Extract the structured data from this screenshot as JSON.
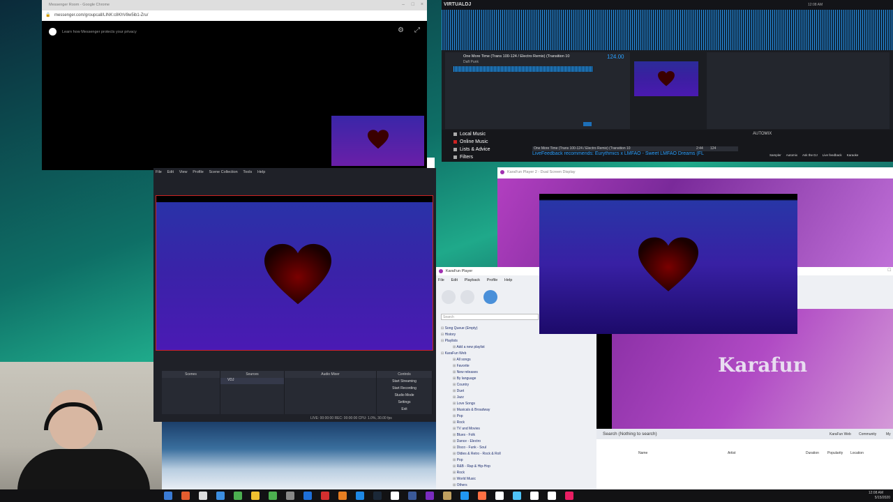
{
  "messenger": {
    "window_title": "Messenger Room - Google Chrome",
    "url": "messenger.com/groupcall/LINK:c8KhV8w5ib1-Zru/",
    "privacy_text": "Learn how Messenger protects your privacy"
  },
  "virtualdj": {
    "logo": "VIRTUALDJ",
    "clock": "12:08 AM",
    "track_title": "One More Time (Trans 100-124 / Electro Remix) (Transition 10",
    "track_artist": "Daft Punk",
    "bpm": "124.00",
    "browser_items": [
      {
        "label": "Local Music"
      },
      {
        "label": "Online Music"
      },
      {
        "label": "Lists & Advice"
      },
      {
        "label": "Filters"
      }
    ],
    "automix_label": "AUTOMIX",
    "feedback_text": "LiveFeedback recommends: Eurythmics x LMFAO - Sweet LMFAO Dreams (FL",
    "playlist_row": "One More Time (Trans 100-124 / Electro Remix) (Transition 10",
    "playlist_row_time": "2:44",
    "playlist_row_bpm": "124",
    "sidebar_buttons": [
      "Sampler",
      "Automix",
      "Ask the DJ",
      "Live feedback",
      "Karaoke"
    ]
  },
  "dual_screen": {
    "window_title": "KaraFun Player 2 - Dual Screen Display",
    "brand": "Karafun"
  },
  "obs": {
    "menu": [
      "File",
      "Edit",
      "View",
      "Profile",
      "Scene Collection",
      "Tools",
      "Help"
    ],
    "docks": {
      "scenes": "Scenes",
      "sources": "Sources",
      "audio_mixer": "Audio Mixer",
      "controls": "Controls"
    },
    "source_item": "VDJ",
    "controls": [
      "Start Streaming",
      "Start Recording",
      "Studio Mode",
      "Settings",
      "Exit"
    ],
    "status": "LIVE: 00:00:00   REC: 00:00:00   CPU: 1.0%, 30.00 fps"
  },
  "karafun": {
    "window_title": "KaraFun Player",
    "menu": [
      "File",
      "Edit",
      "Playback",
      "Profile",
      "Help"
    ],
    "search_placeholder": "Search",
    "tree": [
      {
        "label": "Song Queue (Empty)",
        "level": 0
      },
      {
        "label": "History",
        "level": 0
      },
      {
        "label": "Playlists",
        "level": 0
      },
      {
        "label": "Add a new playlist",
        "level": 1
      },
      {
        "label": "KaraFun Web",
        "level": 0
      },
      {
        "label": "All songs",
        "level": 1
      },
      {
        "label": "Favorite",
        "level": 1
      },
      {
        "label": "New releases",
        "level": 1
      },
      {
        "label": "By language",
        "level": 1
      },
      {
        "label": "Country",
        "level": 1
      },
      {
        "label": "Duet",
        "level": 1
      },
      {
        "label": "Jazz",
        "level": 1
      },
      {
        "label": "Love Songs",
        "level": 1
      },
      {
        "label": "Musicals & Broadway",
        "level": 1
      },
      {
        "label": "Pop",
        "level": 1
      },
      {
        "label": "Rock",
        "level": 1
      },
      {
        "label": "TV and Movies",
        "level": 1
      },
      {
        "label": "Blues - Folk",
        "level": 1
      },
      {
        "label": "Dance - Electro",
        "level": 1
      },
      {
        "label": "Disco - Funk - Soul",
        "level": 1
      },
      {
        "label": "Oldies & Retro - Rock & Roll",
        "level": 1
      },
      {
        "label": "Pop",
        "level": 1
      },
      {
        "label": "R&B - Rap & Hip-Hop",
        "level": 1
      },
      {
        "label": "Rock",
        "level": 1
      },
      {
        "label": "World Music",
        "level": 1
      },
      {
        "label": "Others",
        "level": 1
      }
    ],
    "search_result": "Search (Nothing to search)",
    "filters": [
      "KaraFun Web",
      "Community",
      "My"
    ],
    "columns": [
      "Name",
      "Artist",
      "Duration",
      "Popularity",
      "Location"
    ]
  },
  "taskbar": {
    "time": "12:08 AM",
    "date": "5/15/2020"
  },
  "colors": {
    "accent_red": "#cc2222",
    "vdj_accent": "#2aa0ff",
    "karafun_purple": "#a02fb0",
    "heart_dark": "#3a0000"
  }
}
